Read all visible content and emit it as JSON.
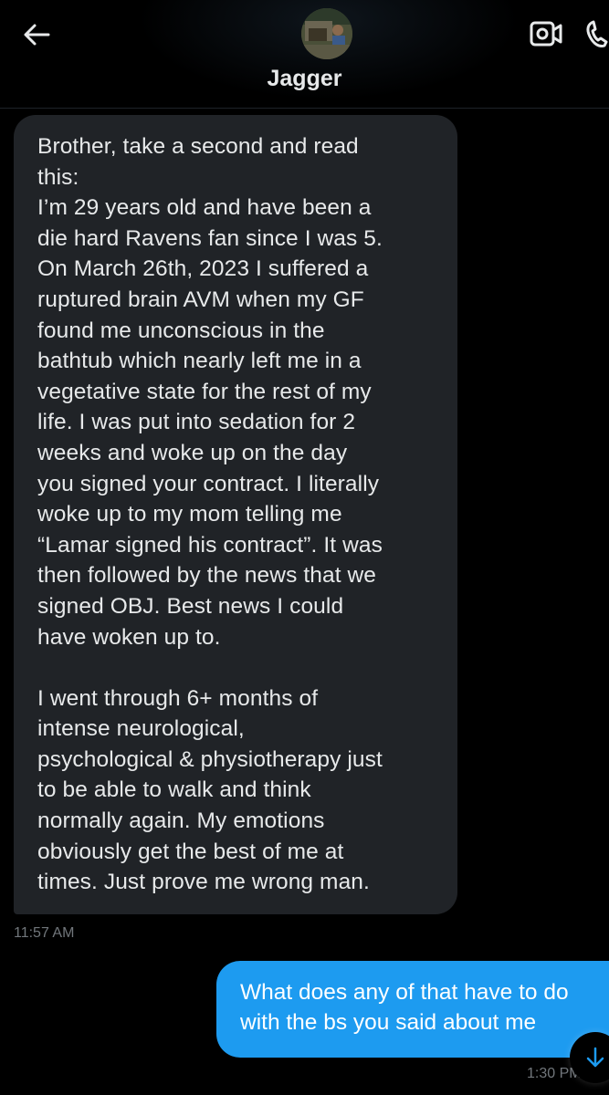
{
  "header": {
    "contact_name": "Jagger",
    "back_icon": "arrow-left-icon",
    "video_icon": "video-call-icon",
    "phone_icon": "phone-icon"
  },
  "messages": [
    {
      "direction": "incoming",
      "text": "Brother, take a second and read\nthis:\nI’m 29 years old and have been a\ndie hard Ravens fan since I was 5.\nOn March 26th, 2023 I suffered a\nruptured brain AVM when my GF\nfound me unconscious in the\nbathtub which nearly left me in a\nvegetative state for the rest of my\nlife. I was put into sedation for 2\nweeks and woke up on the day\nyou signed your contract. I literally\nwoke up to my mom telling me\n“Lamar signed his contract”. It was\nthen followed by the news that we\nsigned OBJ. Best news I could\nhave woken up to.\n\nI went through 6+ months of\nintense neurological,\npsychological & physiotherapy just\nto be able to walk and think\nnormally again. My emotions\nobviously get the best of me at\ntimes. Just prove me wrong man.",
      "time": "11:57 AM"
    },
    {
      "direction": "outgoing",
      "text": "What does any of that have to do\nwith the bs you said about me",
      "time": "1:30 PM"
    }
  ],
  "scroll_down_icon": "arrow-down-icon",
  "colors": {
    "background": "#000000",
    "incoming_bubble": "#202327",
    "outgoing_bubble": "#1d9bf0",
    "text_primary": "#e7e9ea",
    "text_secondary": "#71767b"
  }
}
